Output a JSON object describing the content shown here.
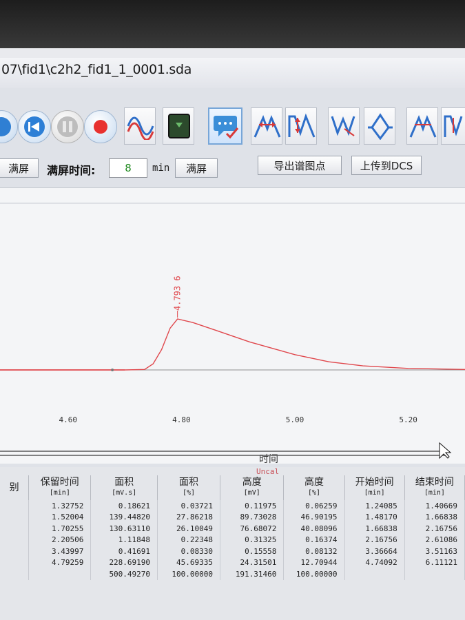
{
  "window": {
    "title": "07\\fid1\\c2h2_fid1_1_0001.sda"
  },
  "toolbar": {
    "buttons": [
      {
        "name": "back-icon"
      },
      {
        "name": "pause-icon"
      },
      {
        "name": "stop-icon"
      },
      {
        "name": "record-icon"
      },
      {
        "name": "wave-icon"
      },
      {
        "name": "square-icon"
      },
      {
        "name": "chat-icon"
      },
      {
        "name": "peak-split-icon"
      },
      {
        "name": "peak-join-icon"
      },
      {
        "name": "valley-icon"
      },
      {
        "name": "diamond-icon"
      },
      {
        "name": "peak-split-2-icon"
      },
      {
        "name": "peak-join-2-icon"
      }
    ]
  },
  "controls": {
    "fullscreen_left": "满屏",
    "fullscreen_time_label": "满屏时间:",
    "fullscreen_time_value": "8",
    "unit": "min",
    "fullscreen_button": "满屏",
    "export_button": "导出谱图点",
    "upload_button": "上传到DCS"
  },
  "chart_data": {
    "type": "line",
    "xlabel": "时间",
    "xticks": [
      "4.60",
      "4.80",
      "5.00",
      "5.20"
    ],
    "xlim": [
      4.48,
      5.3
    ],
    "peak": {
      "x": 4.793,
      "label": "4.793 6"
    },
    "series": [
      {
        "color": "#e0474c",
        "x": [
          4.48,
          4.7,
          4.735,
          4.75,
          4.765,
          4.78,
          4.793,
          4.82,
          4.86,
          4.92,
          5.0,
          5.06,
          5.12,
          5.2,
          5.3
        ],
        "y": [
          0.0,
          0.0,
          0.01,
          0.12,
          0.4,
          0.82,
          1.0,
          0.93,
          0.78,
          0.55,
          0.3,
          0.16,
          0.08,
          0.03,
          0.01
        ]
      }
    ]
  },
  "table": {
    "label": "Uncal",
    "headers": [
      {
        "t": "别",
        "u": ""
      },
      {
        "t": "保留时间",
        "u": "[min]"
      },
      {
        "t": "面积",
        "u": "[mV.s]"
      },
      {
        "t": "面积",
        "u": "[%]"
      },
      {
        "t": "高度",
        "u": "[mV]"
      },
      {
        "t": "高度",
        "u": "[%]"
      },
      {
        "t": "开始时间",
        "u": "[min]"
      },
      {
        "t": "结束时间",
        "u": "[min]"
      }
    ],
    "rows": [
      [
        "",
        "1.32752",
        "0.18621",
        "0.03721",
        "0.11975",
        "0.06259",
        "1.24085",
        "1.40669"
      ],
      [
        "",
        "1.52004",
        "139.44820",
        "27.86218",
        "89.73028",
        "46.90195",
        "1.48170",
        "1.66838"
      ],
      [
        "",
        "1.70255",
        "130.63110",
        "26.10049",
        "76.68072",
        "40.08096",
        "1.66838",
        "2.16756"
      ],
      [
        "",
        "2.20506",
        "1.11848",
        "0.22348",
        "0.31325",
        "0.16374",
        "2.16756",
        "2.61086"
      ],
      [
        "",
        "3.43997",
        "0.41691",
        "0.08330",
        "0.15558",
        "0.08132",
        "3.36664",
        "3.51163"
      ],
      [
        "",
        "4.79259",
        "228.69190",
        "45.69335",
        "24.31501",
        "12.70944",
        "4.74092",
        "6.11121"
      ],
      [
        "",
        "",
        "500.49270",
        "100.00000",
        "191.31460",
        "100.00000",
        "",
        ""
      ]
    ]
  }
}
